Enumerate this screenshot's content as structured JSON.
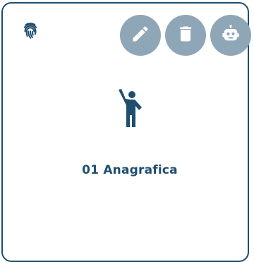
{
  "card": {
    "title": "01 Anagrafica",
    "accent_color": "#1f4e6e",
    "action_button_color": "#8fa6b7"
  },
  "icons": {
    "top_left": "fingerprint-icon",
    "center": "person-waving-icon",
    "actions": [
      "edit-icon",
      "delete-icon",
      "robot-icon"
    ]
  }
}
